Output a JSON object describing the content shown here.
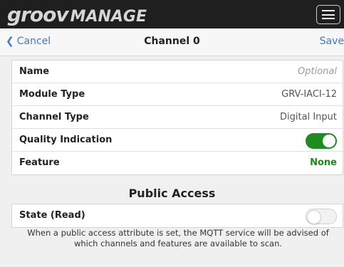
{
  "brand": {
    "logo_main": "groov",
    "logo_sub": "MANAGE"
  },
  "nav": {
    "cancel_label": "Cancel",
    "title": "Channel 0",
    "save_label": "Save"
  },
  "channel_settings": {
    "name_label": "Name",
    "name_placeholder": "Optional",
    "module_type_label": "Module Type",
    "module_type_value": "GRV-IACI-12",
    "channel_type_label": "Channel Type",
    "channel_type_value": "Digital Input",
    "quality_label": "Quality Indication",
    "quality_on": true,
    "feature_label": "Feature",
    "feature_value": "None"
  },
  "public_access": {
    "title": "Public Access",
    "state_label": "State (Read)",
    "state_on": false,
    "help_text": "When a public access attribute is set, the MQTT service will be advised of which channels and features are available to scan."
  },
  "colors": {
    "accent": "#3a7bd5",
    "toggle_on": "#1e8c1e",
    "feature_value": "#1b8a1b",
    "topbar": "#1f1f1f"
  }
}
